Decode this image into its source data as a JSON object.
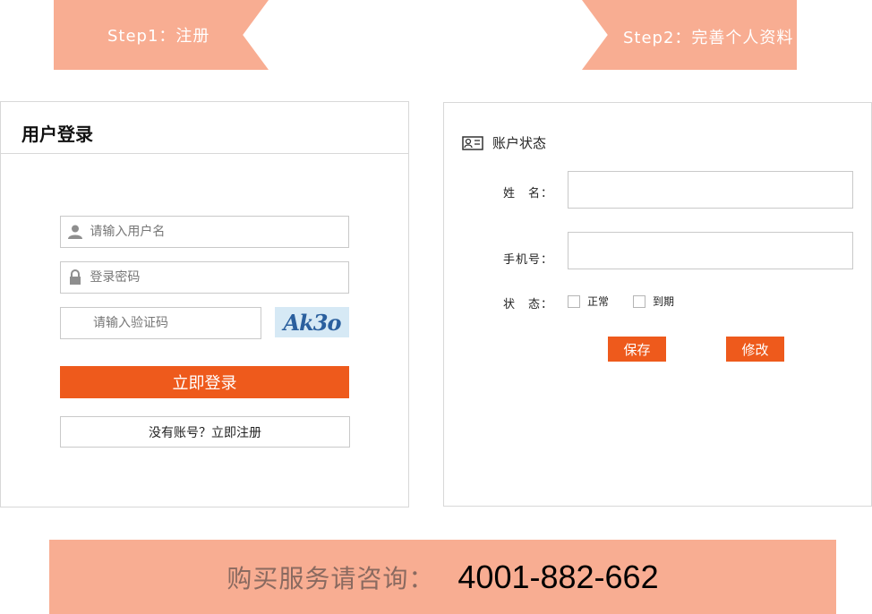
{
  "steps": {
    "step1": "Step1：注册",
    "step2": "Step2：完善个人资料"
  },
  "login": {
    "title": "用户登录",
    "username_placeholder": "请输入用户名",
    "password_placeholder": "登录密码",
    "captcha_placeholder": "请输入验证码",
    "captcha_text": "Ak3o",
    "login_button": "立即登录",
    "register_button": "没有账号？立即注册",
    "user_icon": "user-icon",
    "lock_icon": "lock-icon"
  },
  "account": {
    "title": "账户状态",
    "title_icon": "id-card-icon",
    "name_label": "姓　名：",
    "phone_label": "手机号：",
    "status_label": "状　态：",
    "status_options": [
      "正常",
      "到期"
    ],
    "save_button": "保存",
    "edit_button": "修改"
  },
  "footer": {
    "label": "购买服务请咨询：",
    "phone": "4001-882-662"
  },
  "colors": {
    "accent": "#ee5a1c",
    "banner": "#f8ad92"
  }
}
